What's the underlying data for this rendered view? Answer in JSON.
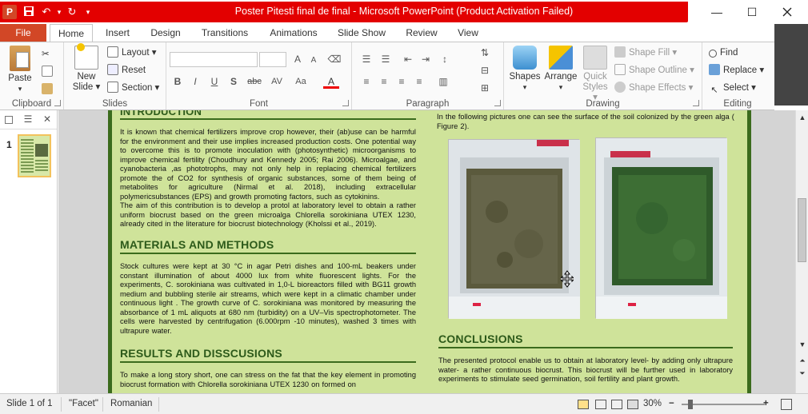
{
  "window": {
    "title": "Poster Pitesti final de final  -  Microsoft PowerPoint (Product Activation Failed)",
    "app_icon": "P",
    "minimize": "—",
    "maximize": "☐"
  },
  "qat": {
    "save_icon": "save-icon",
    "undo_icon": "undo-icon",
    "redo_icon": "redo-icon"
  },
  "tabs": [
    "Home",
    "Insert",
    "Design",
    "Transitions",
    "Animations",
    "Slide Show",
    "Review",
    "View"
  ],
  "file_tab": "File",
  "ribbon": {
    "clipboard": {
      "label": "Clipboard",
      "paste": "Paste"
    },
    "slides": {
      "label": "Slides",
      "new_slide_1": "New",
      "new_slide_2": "Slide ▾",
      "layout": "Layout ▾",
      "reset": "Reset",
      "section": "Section ▾"
    },
    "font": {
      "label": "Font",
      "font_name": "",
      "font_size": "",
      "bold": "B",
      "italic": "I",
      "underline": "U",
      "shadow": "S",
      "strike": "abc",
      "spacing": "AV",
      "case": "Aa",
      "color": "A",
      "grow": "A",
      "shrink": "A"
    },
    "paragraph": {
      "label": "Paragraph"
    },
    "drawing": {
      "label": "Drawing",
      "shapes": "Shapes",
      "arrange": "Arrange",
      "quick_styles_1": "Quick",
      "quick_styles_2": "Styles ▾",
      "shape_fill": "Shape Fill ▾",
      "shape_outline": "Shape Outline ▾",
      "shape_effects": "Shape Effects ▾"
    },
    "editing": {
      "label": "Editing",
      "find": "Find",
      "replace": "Replace ▾",
      "select": "Select ▾"
    }
  },
  "thumbnail": {
    "number": "1"
  },
  "slide": {
    "intro_heading": "INTRODUCTION",
    "intro_p1": "It is known that chemical fertilizers improve crop however, their (ab)use can be harmful for the environment and their use implies increased production costs. One potential way to overcome this is to promote inoculation with (photosynthetic) microorganisms to improve chemical fertility (Choudhury and Kennedy 2005; Rai 2006). Microalgae, and cyanobacteria ,as phototrophs, may not only help in replacing chemical fertilizers promote the of CO2 for synthesis of organic substances, some of them being of metabolites for agriculture (Nirmal et al. 2018), including extracellular polymericsubstances (EPS) and growth promoting factors, such as cytokinins.",
    "intro_p2": "The aim of this  contribution  is to develop a protol at laboratory  level to obtain a rather uniform biocrust  based on the green microalga Chlorella sorokiniana UTEX 1230, already cited in the literature for biocrust biotechnology (Kholssi et al., 2019).",
    "methods_heading": "MATERIALS AND METHODS",
    "methods_p": "Stock cultures were kept at 30 °C in agar Petri dishes and 100-mL beakers under constant illumination of about 4000 lux  from white fluorescent lights. For the experiments, C. sorokiniana was cultivated in 1,0-L bioreactors filled with BG11 growth medium and bubbling sterile air streams, which were kept in a climatic chamber under continuous light . The growth curve of C. sorokiniana was monitored by measuring the absorbance of 1 mL aliquots at 680 nm (turbidity) on a UV–Vis spectrophotometer. The cells were harvested by centrifugation (6.000rpm -10 minutes), washed 3 times with ultrapure water.",
    "results_heading": "RESULTS AND DISSCUSIONS",
    "results_p": "To make a long story short, one can stress on the fat that the key element in promoting biocrust formation with Chlorella sorokiniana UTEX 1230 on formed on",
    "figure_caption": "In the following pictures one can see the surface of the soil colonized by the green alga ( Figure 2).",
    "conclusions_heading": "CONCLUSIONS",
    "conclusions_p": "The presented protocol  enable us to obtain at laboratory level- by adding only ultrapure water- a  rather continuous biocrust. This biocrust will be further used in laboratory experiments to stimulate seed germination, soil fertility  and plant growth."
  },
  "status": {
    "slide": "Slide 1 of 1",
    "theme": "\"Facet\"",
    "language": "Romanian",
    "zoom": "30%",
    "zoom_minus": "−",
    "zoom_plus": "+"
  },
  "colors": {
    "title_bar": "#e30000",
    "file_tab": "#d24726",
    "slide_bg": "#cfe39a",
    "heading": "#2d5a1a",
    "rule": "#3b6b1d"
  }
}
